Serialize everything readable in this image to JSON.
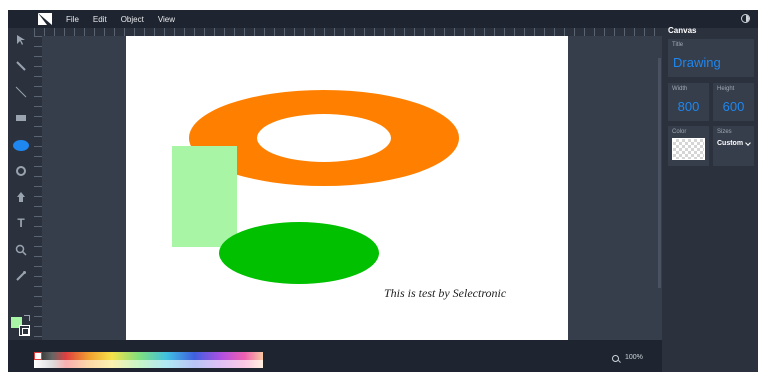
{
  "menu": {
    "items": [
      {
        "label": "File"
      },
      {
        "label": "Edit"
      },
      {
        "label": "Object"
      },
      {
        "label": "View"
      }
    ]
  },
  "toolbar": {
    "tools": [
      "select-icon",
      "pencil-icon",
      "line-icon",
      "rectangle-icon",
      "ellipse-icon",
      "circle-icon",
      "path-icon",
      "text-icon",
      "zoom-icon",
      "eyedropper-icon"
    ],
    "active_tool": "ellipse-icon",
    "fill_color": "#a9f5a6",
    "stroke_color": "#ffffff"
  },
  "canvas": {
    "text": "This is test by Selectronic",
    "shapes": [
      {
        "type": "ring",
        "color": "#ff8000"
      },
      {
        "type": "rect",
        "color": "#a9f5a6"
      },
      {
        "type": "ellipse",
        "color": "#00c000"
      }
    ]
  },
  "panel": {
    "heading": "Canvas",
    "title": {
      "label": "Title",
      "value": "Drawing"
    },
    "width": {
      "label": "Width",
      "value": "800"
    },
    "height": {
      "label": "Height",
      "value": "600"
    },
    "color": {
      "label": "Color"
    },
    "sizes": {
      "label": "Sizes",
      "value": "Custom"
    }
  },
  "status": {
    "zoom": "100%"
  },
  "colors": {
    "accent": "#1e87f0",
    "background": "#2b323e"
  }
}
